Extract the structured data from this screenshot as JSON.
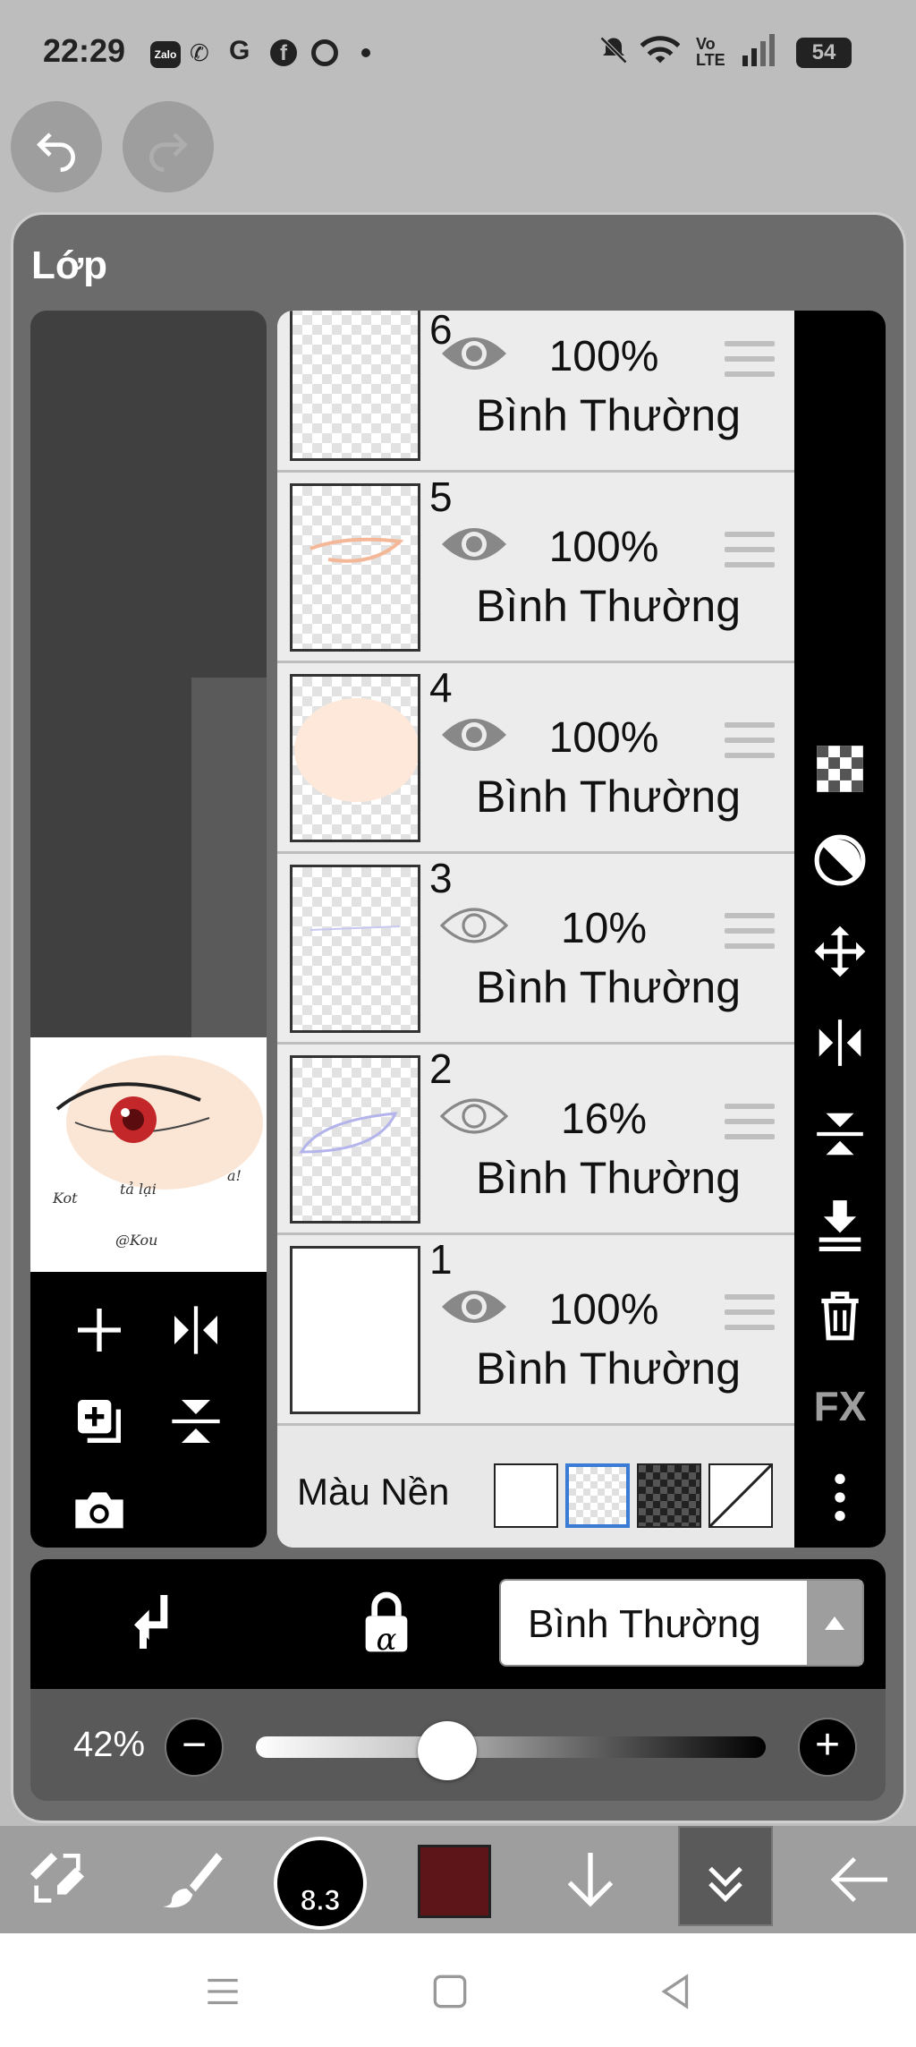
{
  "status_bar": {
    "time": "22:29",
    "left_icons": [
      "zalo-icon",
      "missed-call-icon",
      "google-icon",
      "facebook-icon",
      "chrome-icon",
      "dot-icon"
    ],
    "zalo_label": "Zalo",
    "volte_label": "Vo LTE",
    "battery": "54"
  },
  "panel": {
    "title": "Lớp"
  },
  "layers": [
    {
      "number": "6",
      "opacity": "100%",
      "blend": "Bình Thường",
      "visible": true
    },
    {
      "number": "5",
      "opacity": "100%",
      "blend": "Bình Thường",
      "visible": true
    },
    {
      "number": "4",
      "opacity": "100%",
      "blend": "Bình Thường",
      "visible": true
    },
    {
      "number": "3",
      "opacity": "10%",
      "blend": "Bình Thường",
      "visible": false
    },
    {
      "number": "2",
      "opacity": "16%",
      "blend": "Bình Thường",
      "visible": false
    },
    {
      "number": "1",
      "opacity": "100%",
      "blend": "Bình Thường",
      "visible": true
    }
  ],
  "background_row": {
    "label": "Màu Nền",
    "options": [
      "white",
      "transparent",
      "dark-checker",
      "none"
    ],
    "selected": "transparent"
  },
  "right_tools": {
    "fx_label": "FX",
    "icons": [
      "checker-icon",
      "half-circle-icon",
      "move-icon",
      "flip-horizontal-icon",
      "flip-vertical-icon",
      "merge-down-icon",
      "trash-icon",
      "fx-icon",
      "more-icon"
    ]
  },
  "blend_bar": {
    "blend_mode": "Bình Thường",
    "alpha_lock_label": "α"
  },
  "opacity_row": {
    "label": "42%",
    "value": 0.42,
    "minus": "−",
    "plus": "+"
  },
  "toolbar": {
    "brush_size": "8.3",
    "color": "#5e1519"
  },
  "colors": {
    "panel": "#6b6b6b",
    "accent_select": "#3a7bd5"
  }
}
